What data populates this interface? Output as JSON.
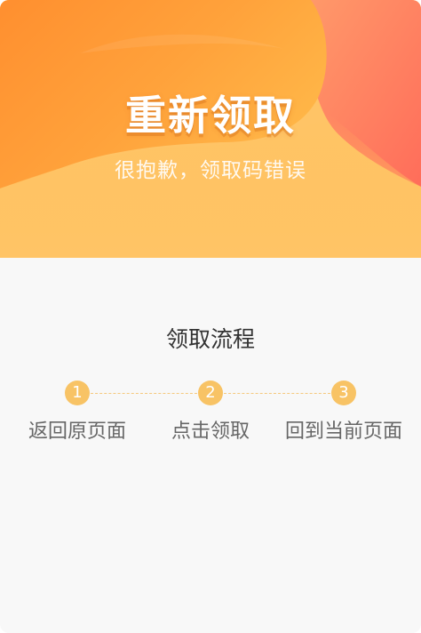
{
  "banner": {
    "title": "重新领取",
    "subtitle": "很抱歉，领取码错误"
  },
  "process": {
    "title": "领取流程",
    "steps": [
      {
        "number": "1",
        "label": "返回原页面"
      },
      {
        "number": "2",
        "label": "点击领取"
      },
      {
        "number": "3",
        "label": "回到当前页面"
      }
    ]
  },
  "colors": {
    "banner_base": "#ffc466",
    "banner_accent": "#ff8c2e",
    "banner_corner": "#ff6b5e",
    "badge": "#f8c365",
    "page_background": "#f8f8f8",
    "title_text": "#333333",
    "step_text": "#666666"
  }
}
